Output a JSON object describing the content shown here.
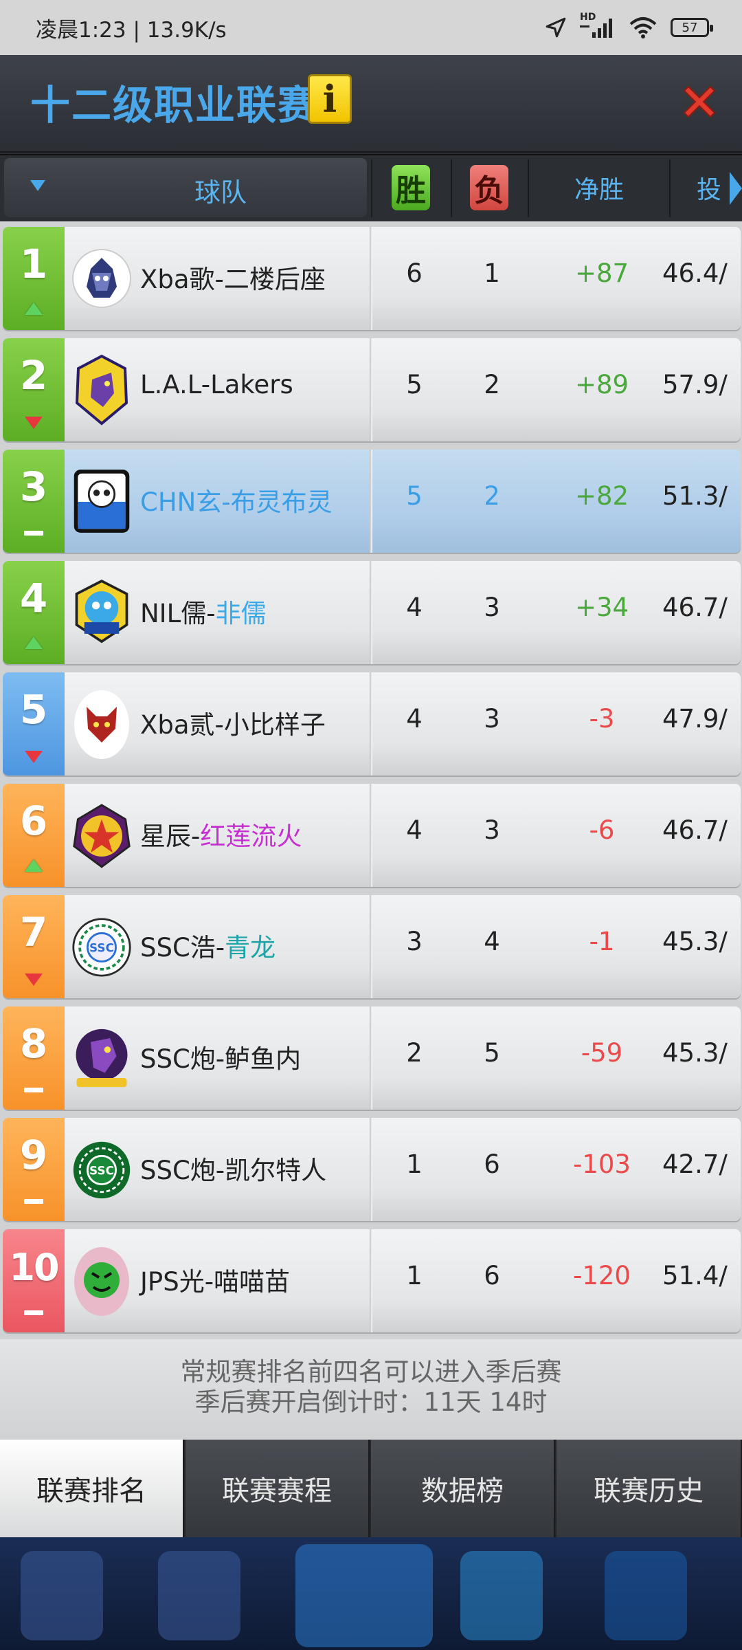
{
  "status_bar": {
    "time_net": "凌晨1:23 | 13.9K/s",
    "network": "HD",
    "battery": "57"
  },
  "header": {
    "title": "十二级职业联赛",
    "info_symbol": "i"
  },
  "columns": {
    "team": "球队",
    "wins": "胜",
    "losses": "负",
    "net": "净胜",
    "next": "投"
  },
  "rows": [
    {
      "rank": "1",
      "trend": "up",
      "name": "Xba歌-二楼后座",
      "wins": "6",
      "losses": "1",
      "net": "+87",
      "pct": "46.4/"
    },
    {
      "rank": "2",
      "trend": "down",
      "name": "L.A.L-Lakers",
      "wins": "5",
      "losses": "2",
      "net": "+89",
      "pct": "57.9/"
    },
    {
      "rank": "3",
      "trend": "flat",
      "name": "CHN玄-布灵布灵",
      "wins": "5",
      "losses": "2",
      "net": "+82",
      "pct": "51.3/"
    },
    {
      "rank": "4",
      "trend": "up",
      "name_prefix": "NIL儒-",
      "name_suffix": "非儒",
      "wins": "4",
      "losses": "3",
      "net": "+34",
      "pct": "46.7/"
    },
    {
      "rank": "5",
      "trend": "down",
      "name": "Xba贰-小比样子",
      "wins": "4",
      "losses": "3",
      "net": "-3",
      "pct": "47.9/"
    },
    {
      "rank": "6",
      "trend": "up",
      "name_prefix": "星辰-",
      "name_suffix": "红莲流火",
      "wins": "4",
      "losses": "3",
      "net": "-6",
      "pct": "46.7/"
    },
    {
      "rank": "7",
      "trend": "down",
      "name_prefix": "SSC浩-",
      "name_suffix": "青龙",
      "wins": "3",
      "losses": "4",
      "net": "-1",
      "pct": "45.3/"
    },
    {
      "rank": "8",
      "trend": "flat",
      "name": "SSC炮-鲈鱼内",
      "wins": "2",
      "losses": "5",
      "net": "-59",
      "pct": "45.3/"
    },
    {
      "rank": "9",
      "trend": "flat",
      "name": "SSC炮-凯尔特人",
      "wins": "1",
      "losses": "6",
      "net": "-103",
      "pct": "42.7/"
    },
    {
      "rank": "10",
      "trend": "flat",
      "name": "JPS光-喵喵苗",
      "wins": "1",
      "losses": "6",
      "net": "-120",
      "pct": "51.4/"
    }
  ],
  "note": {
    "line1": "常规赛排名前四名可以进入季后赛",
    "line2": "季后赛开启倒计时：11天 14时"
  },
  "tabs": [
    "联赛排名",
    "联赛赛程",
    "数据榜",
    "联赛历史"
  ],
  "colors": {
    "title": "#4aa8ea",
    "rank_green": "#5cae25",
    "rank_blue": "#4d96e0",
    "rank_orange": "#f7922a",
    "rank_red": "#ea5660",
    "positive": "#4aa83c",
    "negative": "#ea4a4a"
  }
}
